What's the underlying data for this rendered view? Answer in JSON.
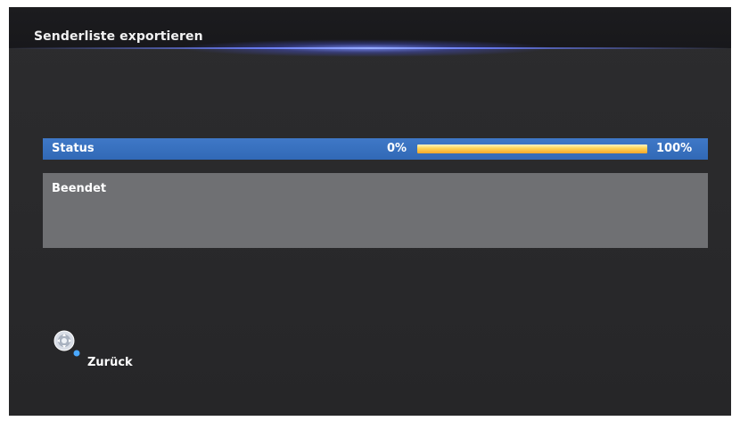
{
  "header": {
    "title": "Senderliste exportieren"
  },
  "status": {
    "label": "Status",
    "progress_start_label": "0%",
    "progress_end_label": "100%",
    "progress_percent": 100
  },
  "info": {
    "message": "Beendet"
  },
  "footer": {
    "back_icon": "remote-navigation-icon",
    "back_label": "Zurück"
  },
  "colors": {
    "status_bar": "#3a72c0",
    "info_box": "#6f7073",
    "progress_fill": "#ffd65a",
    "header_accent": "#8a9cff"
  }
}
